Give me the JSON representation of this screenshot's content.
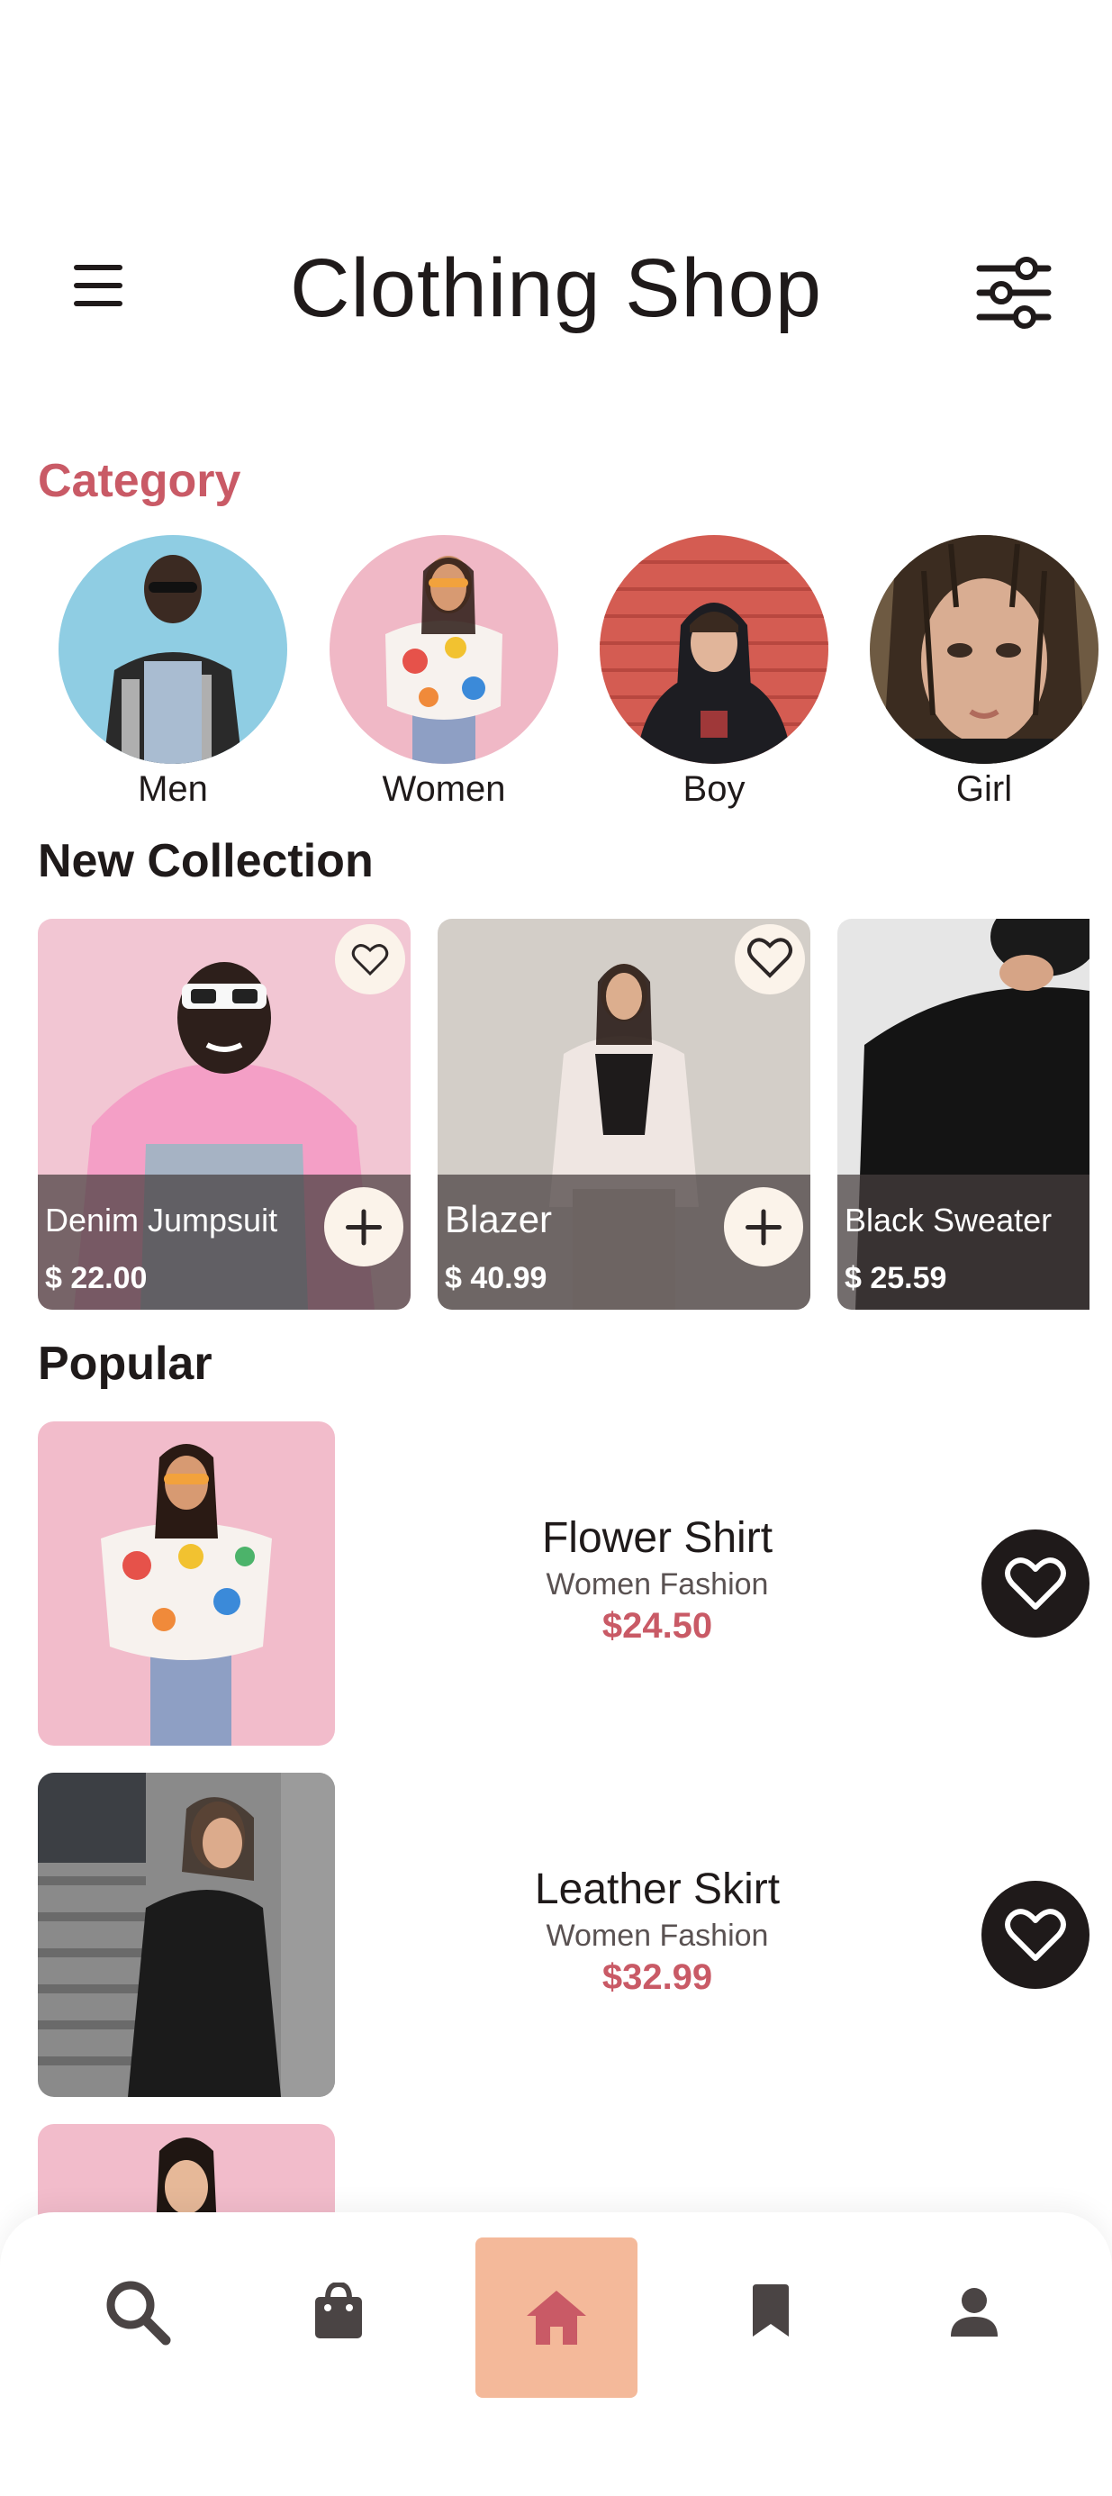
{
  "header": {
    "title": "Clothing Shop",
    "menu_icon": "hamburger-menu-icon",
    "filter_icon": "sliders-filter-icon"
  },
  "category": {
    "title": "Category",
    "items": [
      {
        "label": "Men"
      },
      {
        "label": "Women"
      },
      {
        "label": "Boy"
      },
      {
        "label": "Girl"
      }
    ]
  },
  "new_collection": {
    "title": "New Collection",
    "items": [
      {
        "name": "Denim Jumpsuit",
        "price": "$ 22.00"
      },
      {
        "name": "Blazer",
        "price": "$ 40.99"
      },
      {
        "name": "Black Sweater",
        "price": "$ 25.59"
      }
    ]
  },
  "popular": {
    "title": "Popular",
    "items": [
      {
        "name": "Flower Shirt",
        "subtitle": "Women Fashion",
        "price": "$24.50"
      },
      {
        "name": "Leather Skirt",
        "subtitle": "Women Fashion",
        "price": "$32.99"
      },
      {
        "name": "",
        "subtitle": "",
        "price": ""
      }
    ]
  },
  "bottom_nav": {
    "items": [
      "search-icon",
      "shopping-bag-icon",
      "home-icon",
      "bookmark-icon",
      "profile-icon"
    ],
    "active": "home-icon"
  },
  "colors": {
    "accent": "#c95a66",
    "home_highlight": "#f4b99a",
    "dark": "#1f1a1a",
    "card_button_bg": "#fbf3ea"
  }
}
